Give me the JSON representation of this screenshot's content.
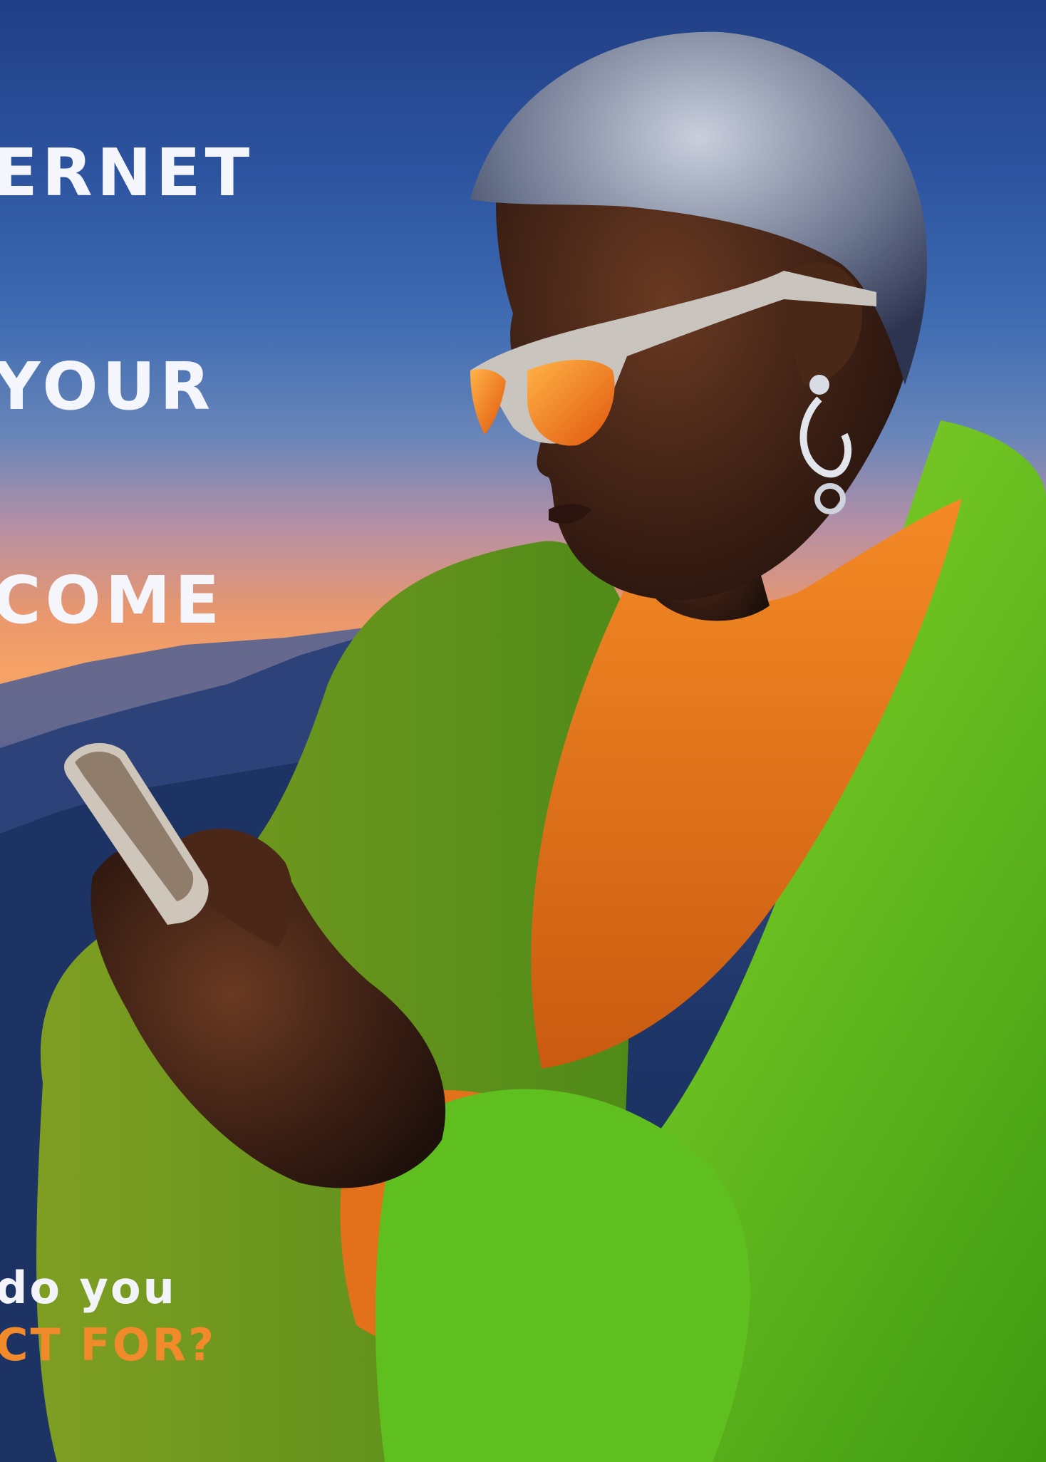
{
  "poster": {
    "headline_lines": [
      "ERNET",
      "YOUR",
      "COME"
    ],
    "tagline_line1": "DO YOU",
    "tagline_line2": "CT FOR?"
  },
  "scene": {
    "subject": "person-with-smartphone",
    "background": "mountain-sunset",
    "icons": [
      "smartphone-icon",
      "sunglasses-icon",
      "earring-icon"
    ]
  },
  "colors": {
    "sky_top": "#213f86",
    "sunset_glow": "#f6a266",
    "coat_green": "#5fbf1f",
    "sweater_orange": "#f07a18",
    "headline_white": "#f4f6fb",
    "tagline_orange": "#f08a2a"
  }
}
